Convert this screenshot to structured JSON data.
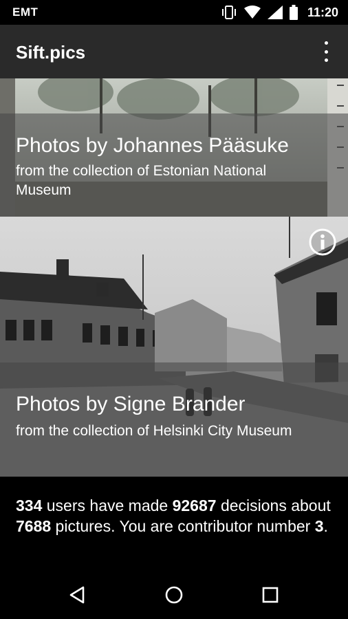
{
  "status_bar": {
    "carrier": "EMT",
    "time": "11:20",
    "icons": [
      "vibrate-icon",
      "wifi-icon",
      "cell-signal-icon",
      "battery-icon"
    ]
  },
  "app_bar": {
    "title": "Sift.pics",
    "menu_icon": "overflow-menu-icon"
  },
  "collections": [
    {
      "title": "Photos by Johannes Pääsuke",
      "subtitle": "from the collection of Estonian National Museum"
    },
    {
      "title": "Photos by Signe Brander",
      "subtitle": "from the collection of Helsinki City Museum",
      "info_icon": "info-icon"
    }
  ],
  "stats": {
    "users": "334",
    "t1": " users have made ",
    "decisions": "92687",
    "t2": " decisions about ",
    "pictures": "7688",
    "t3": " pictures. You are contributor number ",
    "contributor": "3",
    "t4": "."
  },
  "nav_bar": {
    "icons": [
      "back-icon",
      "home-icon",
      "recents-icon"
    ]
  },
  "colors": {
    "app_bar": "#2a2a2a",
    "background": "#000000",
    "caption_overlay": "rgba(70,70,70,0.55)"
  }
}
